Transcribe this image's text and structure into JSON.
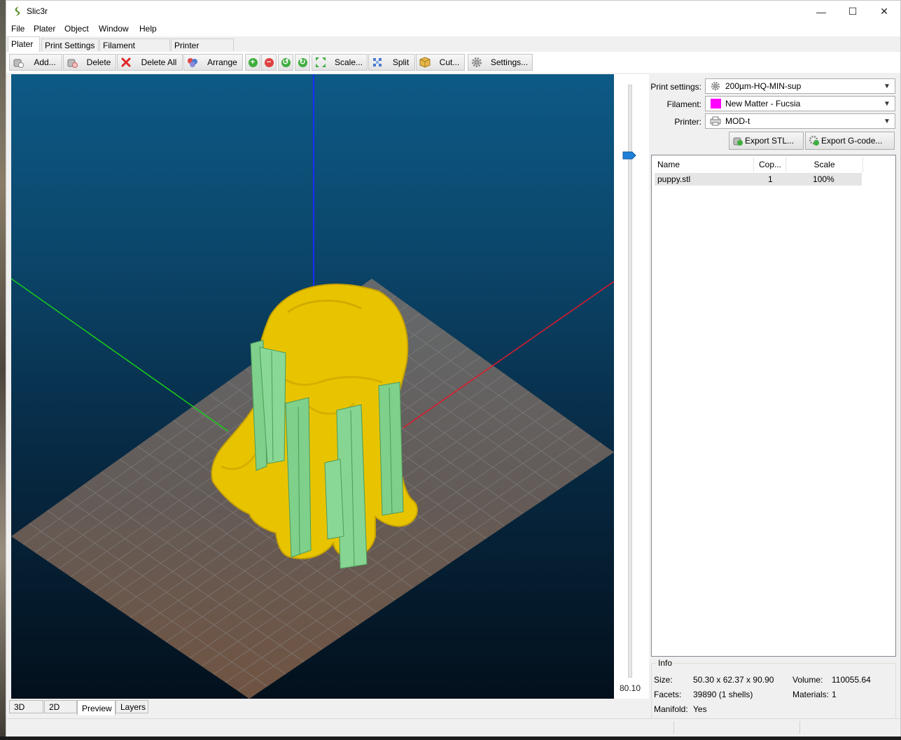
{
  "window": {
    "title": "Slic3r",
    "minimize": "—",
    "maximize": "☐",
    "close": "✕"
  },
  "menu": [
    "File",
    "Plater",
    "Object",
    "Window",
    "Help"
  ],
  "tabs": [
    "Plater",
    "Print Settings",
    "Filament Settings",
    "Printer Settings"
  ],
  "toolbar": {
    "add": "Add...",
    "delete": "Delete",
    "delete_all": "Delete All",
    "arrange": "Arrange",
    "scale": "Scale...",
    "split": "Split",
    "cut": "Cut...",
    "settings": "Settings..."
  },
  "preview": {
    "layer_value": "80.10",
    "layer_fraction": 0.88
  },
  "view_tabs": [
    "3D",
    "2D",
    "Preview",
    "Layers"
  ],
  "settings": {
    "print_label": "Print settings:",
    "print_value": "200µm-HQ-MIN-sup",
    "filament_label": "Filament:",
    "filament_value": "New Matter - Fucsia",
    "filament_color": "#ff00ff",
    "printer_label": "Printer:",
    "printer_value": "MOD-t",
    "export_stl": "Export STL...",
    "export_gcode": "Export G-code..."
  },
  "object_list": {
    "headers": [
      "Name",
      "Cop...",
      "Scale"
    ],
    "rows": [
      {
        "name": "puppy.stl",
        "copies": "1",
        "scale": "100%"
      }
    ]
  },
  "info": {
    "title": "Info",
    "size_label": "Size:",
    "size": "50.30 x 62.37 x 90.90",
    "volume_label": "Volume:",
    "volume": "110055.64",
    "facets_label": "Facets:",
    "facets": "39890 (1 shells)",
    "materials_label": "Materials:",
    "materials": "1",
    "manifold_label": "Manifold:",
    "manifold": "Yes"
  },
  "colors": {
    "model": "#e8c400",
    "support": "#7fd08a",
    "bed": "#6b6a6a",
    "axis_x": "#e0192b",
    "axis_y": "#19d019",
    "axis_z": "#1a2cff"
  }
}
